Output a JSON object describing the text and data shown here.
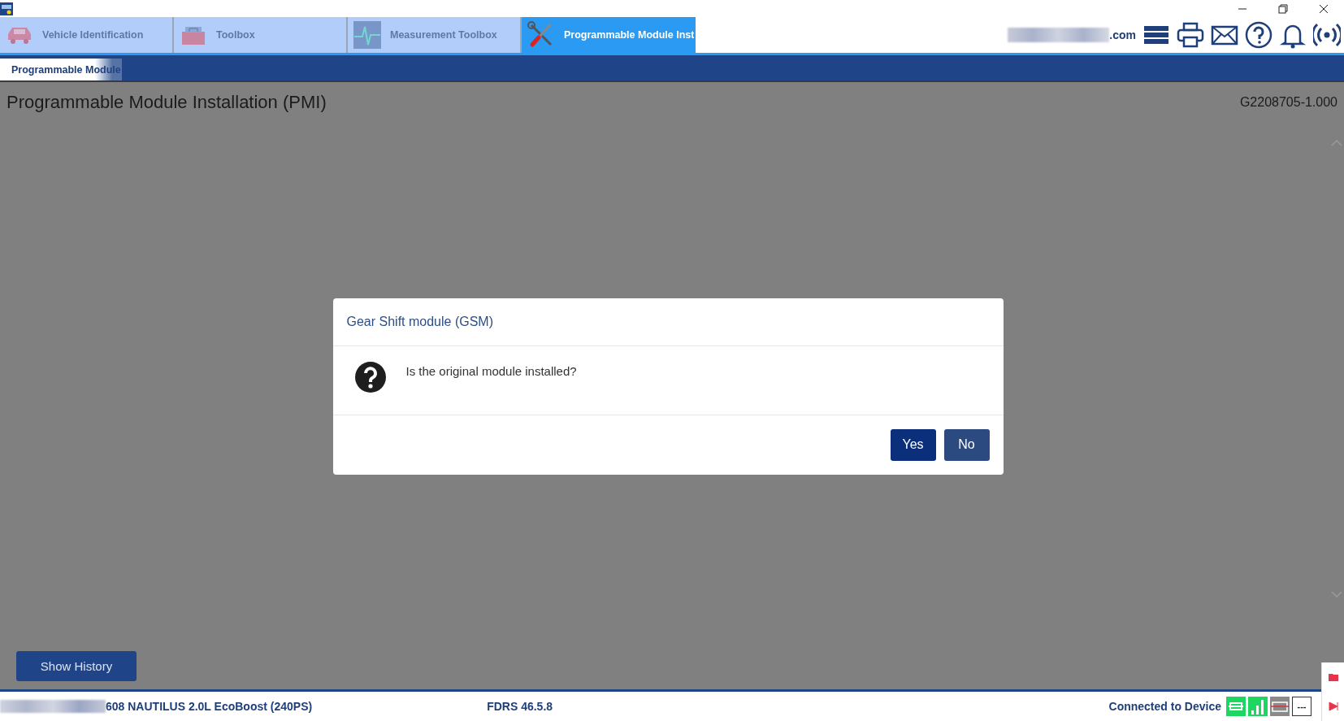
{
  "top_tabs": [
    {
      "label": "Vehicle Identification",
      "kind": "car",
      "selected": false
    },
    {
      "label": "Toolbox",
      "kind": "toolbox",
      "selected": false
    },
    {
      "label": "Measurement Toolbox",
      "kind": "wave",
      "selected": false
    },
    {
      "label": "Programmable Module Inst",
      "kind": "tools",
      "selected": true
    }
  ],
  "account": {
    "email_suffix": ".com"
  },
  "sub_tabs": [
    {
      "label": "Programmable Module",
      "selected": true
    }
  ],
  "page": {
    "title": "Programmable Module Installation (PMI)",
    "code": "G2208705-1.000"
  },
  "dialog": {
    "title": "Gear Shift module (GSM)",
    "message": "Is the original module installed?",
    "buttons": [
      {
        "label": "Yes",
        "hovered": false
      },
      {
        "label": "No",
        "hovered": true
      }
    ]
  },
  "show_history_button": "Show History",
  "status_bar": {
    "vehicle": "608 NAUTILUS 2.0L EcoBoost (240PS)",
    "version": "FDRS 46.5.8",
    "connection": "Connected to Device",
    "indicator": "---"
  }
}
